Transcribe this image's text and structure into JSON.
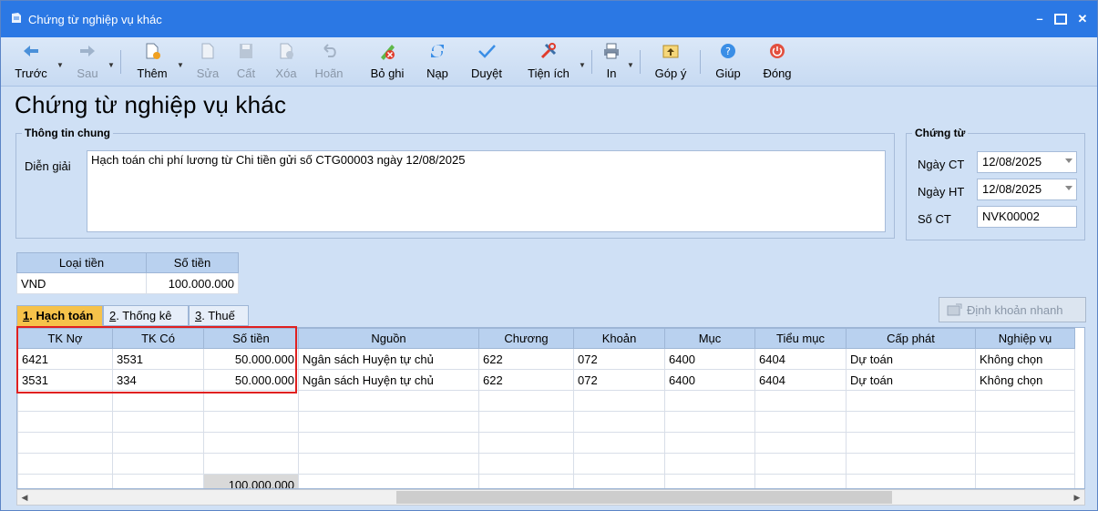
{
  "window": {
    "title": "Chứng từ nghiệp vụ khác"
  },
  "toolbar": {
    "prev": "Trước",
    "next": "Sau",
    "add": "Thêm",
    "edit": "Sửa",
    "save": "Cất",
    "delete": "Xóa",
    "undo": "Hoãn",
    "unpost": "Bỏ ghi",
    "load": "Nạp",
    "approve": "Duyệt",
    "utility": "Tiện ích",
    "print": "In",
    "feedback": "Góp ý",
    "help": "Giúp",
    "close": "Đóng"
  },
  "page_title": "Chứng từ nghiệp vụ khác",
  "general": {
    "legend": "Thông tin chung",
    "desc_label": "Diễn giải",
    "desc_value": "Hạch toán chi phí lương từ Chi tiền gửi số CTG00003 ngày 12/08/2025"
  },
  "voucher": {
    "legend": "Chứng từ",
    "date_ct_label": "Ngày CT",
    "date_ct_value": "12/08/2025",
    "date_ht_label": "Ngày HT",
    "date_ht_value": "12/08/2025",
    "number_label": "Số CT",
    "number_value": "NVK00002"
  },
  "currency": {
    "headers": [
      "Loại tiền",
      "Số tiền"
    ],
    "type": "VND",
    "amount": "100.000.000"
  },
  "quick_button": "Định khoản nhanh",
  "tabs": [
    {
      "num": "1",
      "label": ". Hạch toán"
    },
    {
      "num": "2",
      "label": ". Thống kê"
    },
    {
      "num": "3",
      "label": ". Thuế"
    }
  ],
  "grid": {
    "headers": [
      "TK Nợ",
      "TK Có",
      "Số tiền",
      "Nguồn",
      "Chương",
      "Khoản",
      "Mục",
      "Tiểu mục",
      "Cấp phát",
      "Nghiệp vụ"
    ],
    "rows": [
      [
        "6421",
        "3531",
        "50.000.000",
        "Ngân sách Huyện tự chủ",
        "622",
        "072",
        "6400",
        "6404",
        "Dự toán",
        "Không chọn"
      ],
      [
        "3531",
        "334",
        "50.000.000",
        "Ngân sách Huyện tự chủ",
        "622",
        "072",
        "6400",
        "6404",
        "Dự toán",
        "Không chọn"
      ]
    ],
    "total": "100.000.000"
  }
}
